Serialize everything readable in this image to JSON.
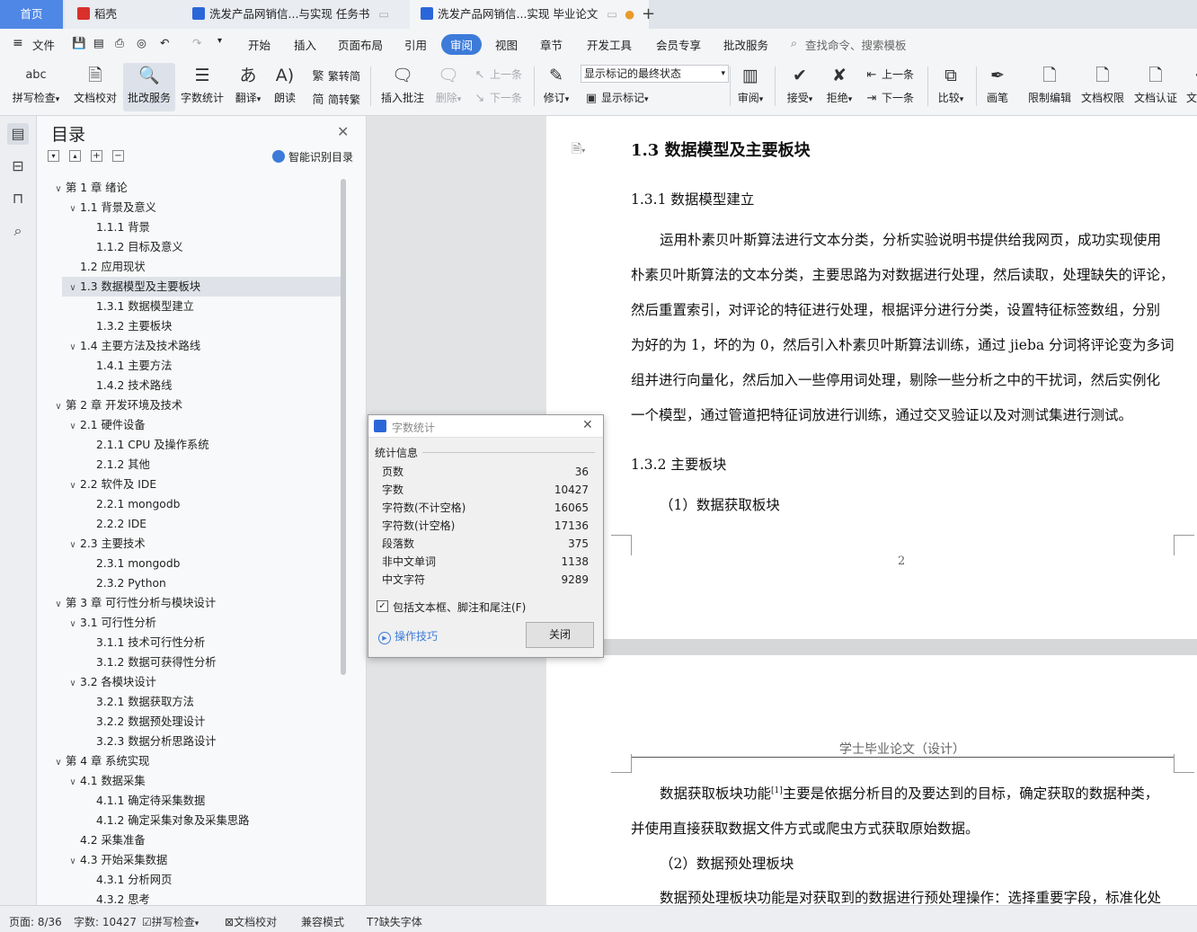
{
  "tabs": [
    {
      "label": "首页",
      "active": true
    },
    {
      "label": "稻壳"
    },
    {
      "label": "洗发产品网销信...与实现 任务书"
    },
    {
      "label": "洗发产品网销信...实现 毕业论文"
    }
  ],
  "menu": {
    "file": "文件",
    "items": [
      "开始",
      "插入",
      "页面布局",
      "引用",
      "审阅",
      "视图",
      "章节",
      "开发工具",
      "会员专享",
      "批改服务"
    ],
    "active": "审阅",
    "search_placeholder": "查找命令、搜索模板"
  },
  "ribbon": {
    "spell": "拼写检查",
    "proof": "文档校对",
    "correction": "批改服务",
    "wordcount": "字数统计",
    "translate": "翻译",
    "read": "朗读",
    "to_trad": "繁转简",
    "to_simp": "简转繁",
    "insert_comment": "插入批注",
    "delete": "删除",
    "prev": "上一条",
    "next": "下一条",
    "revise": "修订",
    "markup_select": "显示标记的最终状态",
    "show_markup": "显示标记",
    "review": "审阅",
    "accept": "接受",
    "reject": "拒绝",
    "prev2": "上一条",
    "next2": "下一条",
    "compare": "比较",
    "pen": "画笔",
    "restrict": "限制编辑",
    "permission": "文档权限",
    "certify": "文档认证",
    "more": "文"
  },
  "toc": {
    "title": "目录",
    "smart": "智能识别目录",
    "items": [
      {
        "label": "第 1 章  绪论",
        "level": 0,
        "chev": true
      },
      {
        "label": "1.1  背景及意义",
        "level": 1,
        "chev": true
      },
      {
        "label": "1.1.1  背景",
        "level": 2
      },
      {
        "label": "1.1.2  目标及意义",
        "level": 2
      },
      {
        "label": "1.2  应用现状",
        "level": 1
      },
      {
        "label": "1.3  数据模型及主要板块",
        "level": 1,
        "chev": true,
        "selected": true
      },
      {
        "label": "1.3.1  数据模型建立",
        "level": 2
      },
      {
        "label": "1.3.2  主要板块",
        "level": 2
      },
      {
        "label": "1.4  主要方法及技术路线",
        "level": 1,
        "chev": true
      },
      {
        "label": "1.4.1  主要方法",
        "level": 2
      },
      {
        "label": "1.4.2 技术路线",
        "level": 2
      },
      {
        "label": "第 2 章  开发环境及技术",
        "level": 0,
        "chev": true
      },
      {
        "label": "2.1 硬件设备",
        "level": 1,
        "chev": true
      },
      {
        "label": "2.1.1 CPU 及操作系统",
        "level": 2
      },
      {
        "label": "2.1.2  其他",
        "level": 2
      },
      {
        "label": "2.2 软件及 IDE",
        "level": 1,
        "chev": true
      },
      {
        "label": "2.2.1 mongodb",
        "level": 2
      },
      {
        "label": "2.2.2 IDE",
        "level": 2
      },
      {
        "label": "2.3 主要技术",
        "level": 1,
        "chev": true
      },
      {
        "label": "2.3.1 mongodb",
        "level": 2
      },
      {
        "label": "2.3.2 Python",
        "level": 2
      },
      {
        "label": "第 3 章  可行性分析与模块设计",
        "level": 0,
        "chev": true
      },
      {
        "label": "3.1  可行性分析",
        "level": 1,
        "chev": true
      },
      {
        "label": "3.1.1  技术可行性分析",
        "level": 2
      },
      {
        "label": "3.1.2  数据可获得性分析",
        "level": 2
      },
      {
        "label": "3.2  各模块设计",
        "level": 1,
        "chev": true
      },
      {
        "label": "3.2.1  数据获取方法",
        "level": 2
      },
      {
        "label": "3.2.2  数据预处理设计",
        "level": 2
      },
      {
        "label": "3.2.3  数据分析思路设计",
        "level": 2
      },
      {
        "label": "第 4 章  系统实现",
        "level": 0,
        "chev": true
      },
      {
        "label": "4.1 数据采集",
        "level": 1,
        "chev": true
      },
      {
        "label": "4.1.1 确定待采集数据",
        "level": 2
      },
      {
        "label": "4.1.2 确定采集对象及采集思路",
        "level": 2
      },
      {
        "label": "4.2 采集准备",
        "level": 1
      },
      {
        "label": "4.3 开始采集数据",
        "level": 1,
        "chev": true
      },
      {
        "label": "4.3.1 分析网页",
        "level": 2
      },
      {
        "label": "4.3.2 思考",
        "level": 2
      }
    ]
  },
  "doc": {
    "h1": "1.3  数据模型及主要板块",
    "h2a": "1.3.1 数据模型建立",
    "para1": [
      "运用朴素贝叶斯算法进行文本分类，分析实验说明书提供给我网页，成功实现使用",
      "朴素贝叶斯算法的文本分类，主要思路为对数据进行处理，然后读取，处理缺失的评论，",
      "然后重置索引，对评论的特征进行处理，根据评分进行分类，设置特征标签数组，分别",
      "为好的为 1，坏的为 0，然后引入朴素贝叶斯算法训练，通过 jieba 分词将评论变为多词",
      "组并进行向量化，然后加入一些停用词处理，剔除一些分析之中的干扰词，然后实例化",
      "一个模型，通过管道把特征词放进行训练，通过交叉验证以及对测试集进行测试。"
    ],
    "h2b": "1.3.2  主要板块",
    "sub1": "（1）数据获取板块",
    "page_num": "2",
    "header2": "学士毕业论文（设计）",
    "para2": [
      "数据获取板块功能",
      "主要是依据分析目的及要达到的目标，确定获取的数据种类，",
      "并使用直接获取数据文件方式或爬虫方式获取原始数据。"
    ],
    "cite": "[1]",
    "sub2": "（2）数据预处理板块",
    "para3": "数据预处理板块功能是对获取到的数据进行预处理操作：选择重要字段，标准化处"
  },
  "dialog": {
    "title": "字数统计",
    "section": "统计信息",
    "rows": [
      {
        "label": "页数",
        "value": "36"
      },
      {
        "label": "字数",
        "value": "10427"
      },
      {
        "label": "字符数(不计空格)",
        "value": "16065"
      },
      {
        "label": "字符数(计空格)",
        "value": "17136"
      },
      {
        "label": "段落数",
        "value": "375"
      },
      {
        "label": "非中文单词",
        "value": "1138"
      },
      {
        "label": "中文字符",
        "value": "9289"
      }
    ],
    "checkbox": "包括文本框、脚注和尾注(F)",
    "tips": "操作技巧",
    "close": "关闭"
  },
  "status": {
    "page": "页面: 8/36",
    "words": "字数: 10427",
    "spell": "拼写检查",
    "proof": "文档校对",
    "compat": "兼容模式",
    "missing_font": "缺失字体"
  },
  "colors": {
    "accent": "#3d7bd9",
    "wps_red": "#d9302c",
    "doc_blue": "#2b66d9"
  }
}
